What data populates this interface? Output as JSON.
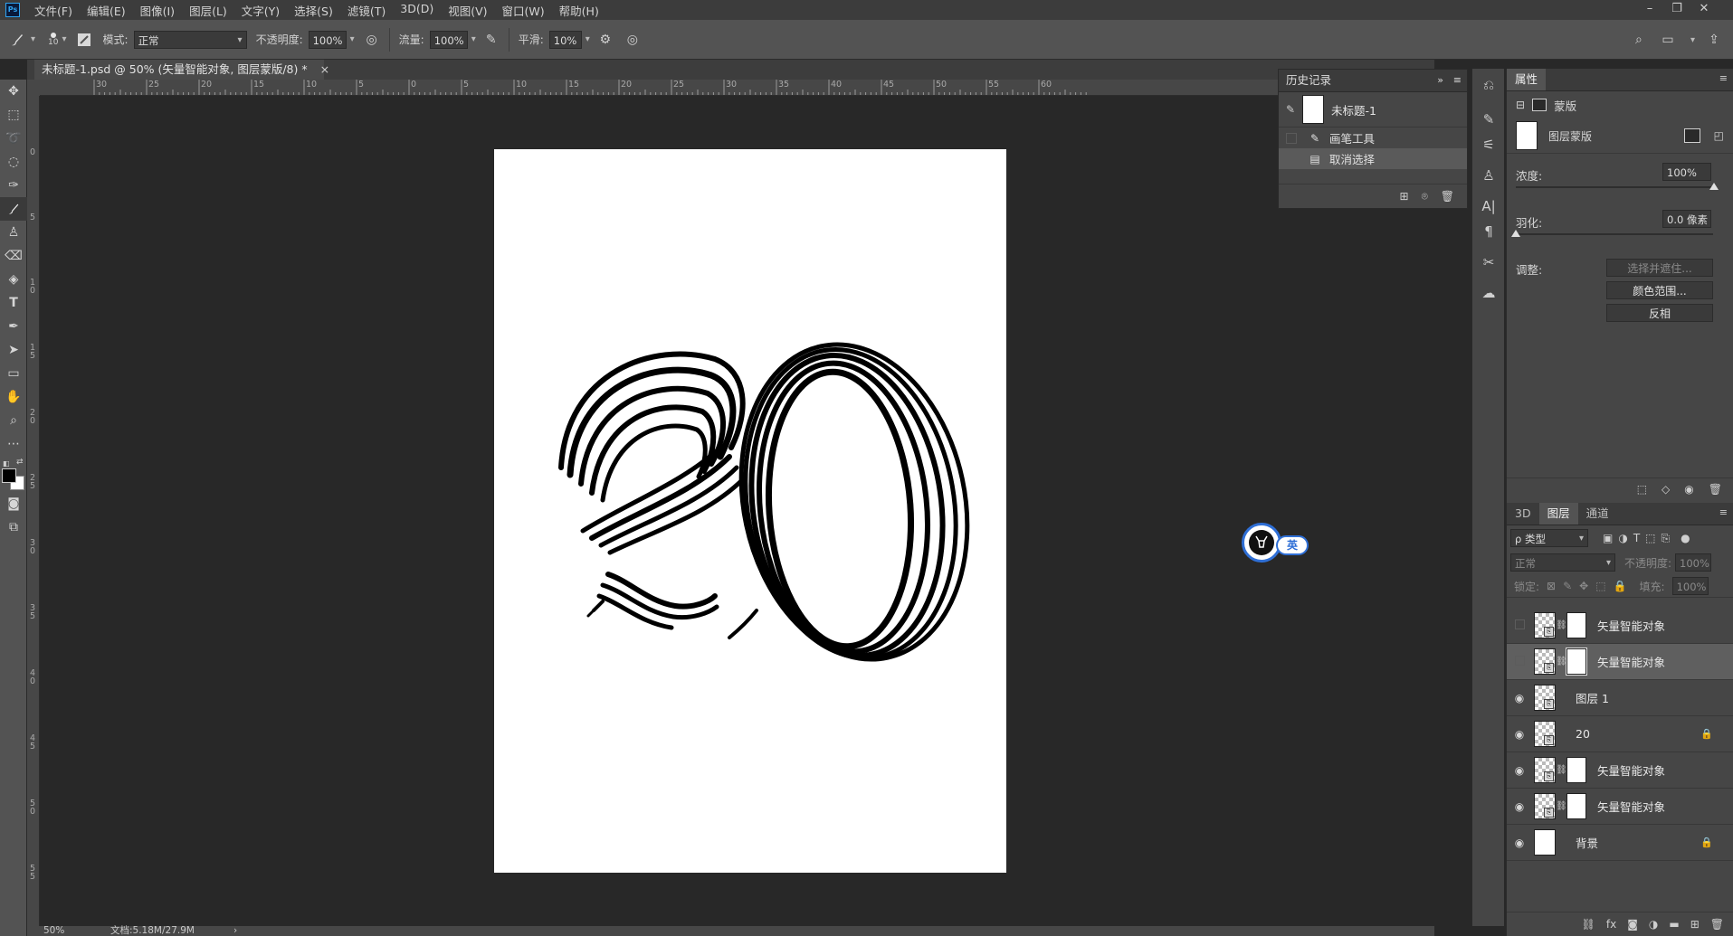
{
  "app": {
    "logo": "Ps"
  },
  "menu": [
    "文件(F)",
    "编辑(E)",
    "图像(I)",
    "图层(L)",
    "文字(Y)",
    "选择(S)",
    "滤镜(T)",
    "3D(D)",
    "视图(V)",
    "窗口(W)",
    "帮助(H)"
  ],
  "options": {
    "brush_size": "10",
    "mode_label": "模式:",
    "mode_value": "正常",
    "opacity_label": "不透明度:",
    "opacity_value": "100%",
    "flow_label": "流量:",
    "flow_value": "100%",
    "smooth_label": "平滑:",
    "smooth_value": "10%"
  },
  "document": {
    "tab_title": "未标题-1.psd @ 50% (矢量智能对象, 图层蒙版/8) *",
    "close": "×"
  },
  "ruler_h": [
    "30",
    "25",
    "20",
    "15",
    "10",
    "5",
    "0",
    "5",
    "10",
    "15",
    "20",
    "25",
    "30",
    "35",
    "40",
    "45",
    "50",
    "55",
    "60"
  ],
  "ruler_v": [
    "0",
    "5",
    "1 0",
    "1 5",
    "2 0",
    "2 5",
    "3 0",
    "3 5",
    "4 0",
    "4 5",
    "5 0",
    "5 5"
  ],
  "status": {
    "zoom": "50%",
    "doc_size": "文档:5.18M/27.9M",
    "arrow": "›"
  },
  "history": {
    "title": "历史记录",
    "snapshot": "未标题-1",
    "items": [
      "画笔工具",
      "取消选择"
    ],
    "selected_index": 1
  },
  "properties": {
    "title": "属性",
    "mask_type": "蒙版",
    "mask_name": "图层蒙版",
    "density_label": "浓度:",
    "density_value": "100%",
    "density_level": 100,
    "feather_label": "羽化:",
    "feather_value": "0.0 像素",
    "feather_level": 0,
    "adjust_label": "调整:",
    "btn_select_mask": "选择并遮住...",
    "btn_color_range": "颜色范围...",
    "btn_invert": "反相"
  },
  "layers_panel": {
    "tabs": [
      "3D",
      "图层",
      "通道"
    ],
    "active_tab": 1,
    "filter_kind": "ρ 类型",
    "blend_mode": "正常",
    "opacity_label": "不透明度:",
    "opacity_value": "100%",
    "lock_label": "锁定:",
    "fill_label": "填充:",
    "fill_value": "100%",
    "layers": [
      {
        "name": "矢量智能对象",
        "visible": false,
        "mask": true,
        "selected": false,
        "locked": false
      },
      {
        "name": "矢量智能对象",
        "visible": false,
        "mask": true,
        "selected": true,
        "locked": false
      },
      {
        "name": "图层 1",
        "visible": true,
        "mask": false,
        "selected": false,
        "locked": false
      },
      {
        "name": "20",
        "visible": true,
        "mask": false,
        "selected": false,
        "locked": true
      },
      {
        "name": "矢量智能对象",
        "visible": true,
        "mask": true,
        "selected": false,
        "locked": false
      },
      {
        "name": "矢量智能对象",
        "visible": true,
        "mask": true,
        "selected": false,
        "locked": false
      },
      {
        "name": "背景",
        "visible": true,
        "mask": false,
        "selected": false,
        "locked": true
      }
    ]
  },
  "ime": {
    "label": "英"
  },
  "colors": {
    "accent": "#2fa3f0",
    "panel": "#464646",
    "canvas_bg": "#282828"
  }
}
